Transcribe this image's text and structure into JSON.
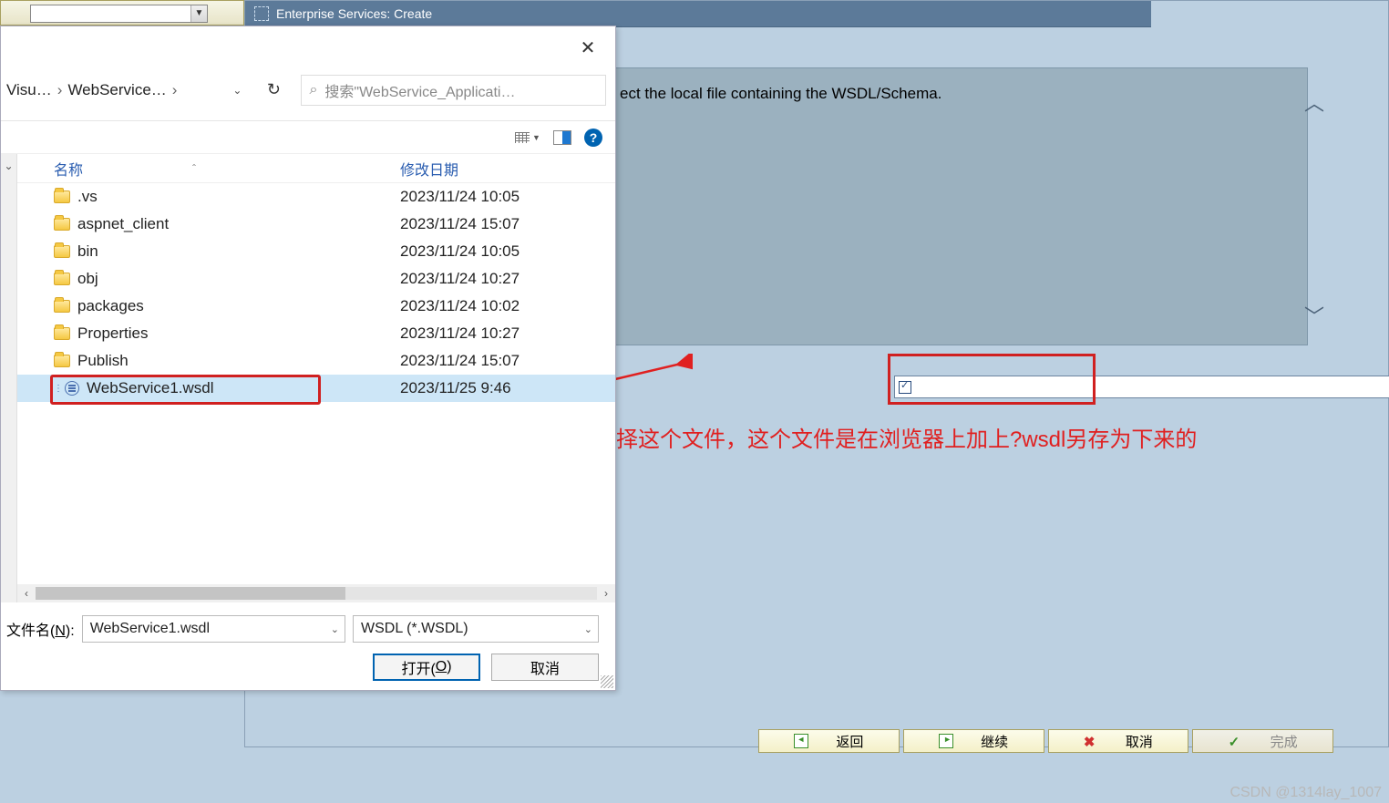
{
  "sap": {
    "title": "Enterprise Services: Create",
    "desc_suffix": "ect the local file containing the WSDL/Schema.",
    "buttons": {
      "back": "返回",
      "next": "继续",
      "cancel": "取消",
      "done": "完成"
    }
  },
  "annotation": "选择这个文件，这个文件是在浏览器上加上?wsdl另存为下来的",
  "watermark": "CSDN @1314lay_1007",
  "dialog": {
    "breadcrumb": {
      "p1": "Visu…",
      "p2": "WebService…"
    },
    "search_placeholder": "搜索\"WebService_Applicati…",
    "columns": {
      "name": "名称",
      "date": "修改日期"
    },
    "rows": [
      {
        "name": ".vs",
        "date": "2023/11/24 10:05",
        "type": "folder"
      },
      {
        "name": "aspnet_client",
        "date": "2023/11/24 15:07",
        "type": "folder"
      },
      {
        "name": "bin",
        "date": "2023/11/24 10:05",
        "type": "folder"
      },
      {
        "name": "obj",
        "date": "2023/11/24 10:27",
        "type": "folder"
      },
      {
        "name": "packages",
        "date": "2023/11/24 10:02",
        "type": "folder"
      },
      {
        "name": "Properties",
        "date": "2023/11/24 10:27",
        "type": "folder"
      },
      {
        "name": "Publish",
        "date": "2023/11/24 15:07",
        "type": "folder"
      },
      {
        "name": "WebService1.wsdl",
        "date": "2023/11/25 9:46",
        "type": "file",
        "selected": true
      }
    ],
    "filename_label_pre": "文件名(",
    "filename_label_key": "N",
    "filename_label_post": "):",
    "filename_value": "WebService1.wsdl",
    "filetype_value": "WSDL (*.WSDL)",
    "open_btn_pre": "打开(",
    "open_btn_key": "O",
    "open_btn_post": ")",
    "cancel_btn": "取消"
  }
}
